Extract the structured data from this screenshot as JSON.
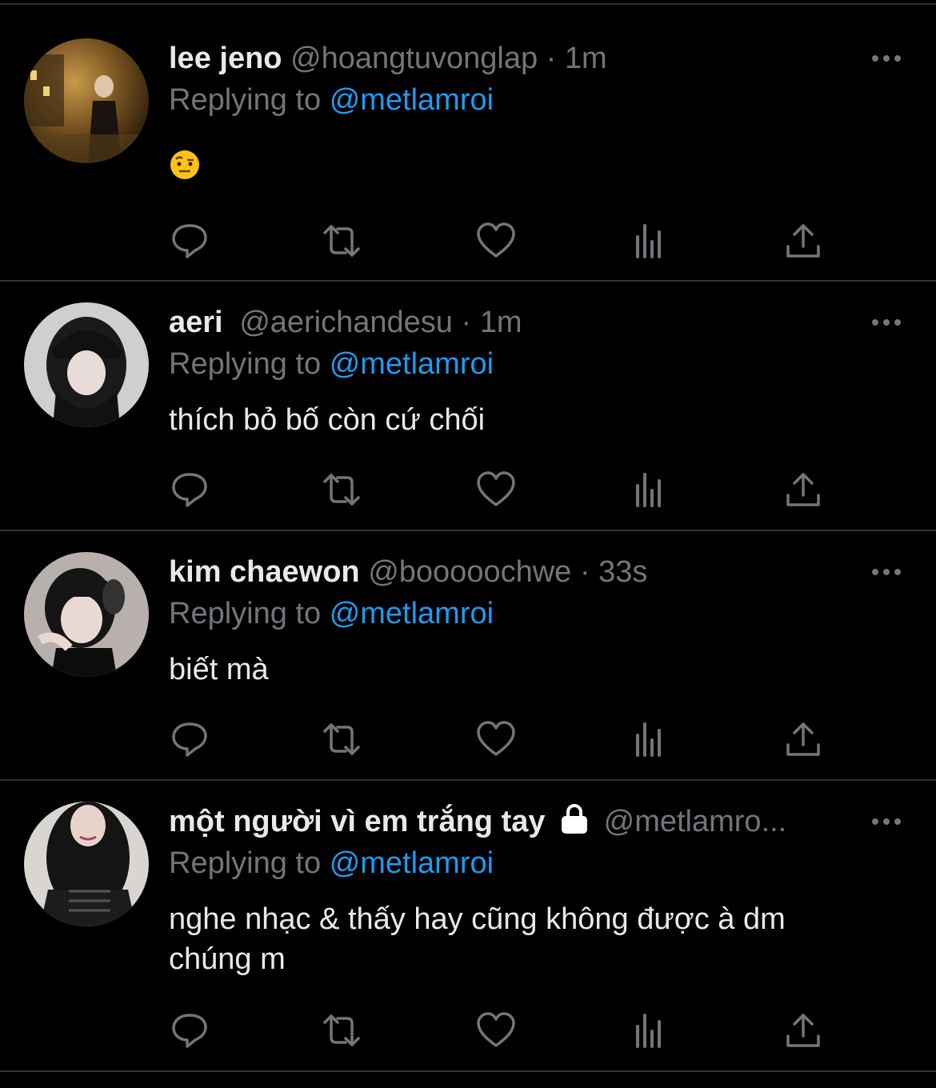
{
  "colors": {
    "background": "#000000",
    "text": "#e7e9ea",
    "muted": "#71767b",
    "link": "#1d9bf0",
    "divider": "#2f3336"
  },
  "icons": {
    "reply": "reply-icon",
    "retweet": "retweet-icon",
    "like": "heart-icon",
    "views": "views-icon",
    "share": "share-icon",
    "more": "more-icon",
    "lock": "lock-icon"
  },
  "tweets": [
    {
      "name": "lee jeno",
      "handle": "@hoangtuvonglap",
      "dot": "·",
      "time": "1m",
      "replying_prefix": "Replying to",
      "replying_handle": "@metlamroi",
      "text": "🤨",
      "emoji": "raised-eyebrow-face"
    },
    {
      "name": "aeri",
      "handle": "@aerichandesu",
      "dot": "·",
      "time": "1m",
      "replying_prefix": "Replying to",
      "replying_handle": "@metlamroi",
      "text": "thích bỏ bố còn cứ chối"
    },
    {
      "name": "kim chaewon",
      "handle": "@booooochwe",
      "dot": "·",
      "time": "33s",
      "replying_prefix": "Replying to",
      "replying_handle": "@metlamroi",
      "text": "biết mà"
    },
    {
      "name": "một người vì em trắng tay",
      "handle": "@metlamro...",
      "locked": true,
      "replying_prefix": "Replying to",
      "replying_handle": "@metlamroi",
      "text_line1": "nghe nhạc & thấy hay cũng không được à dm",
      "text_line2": "chúng m"
    }
  ]
}
